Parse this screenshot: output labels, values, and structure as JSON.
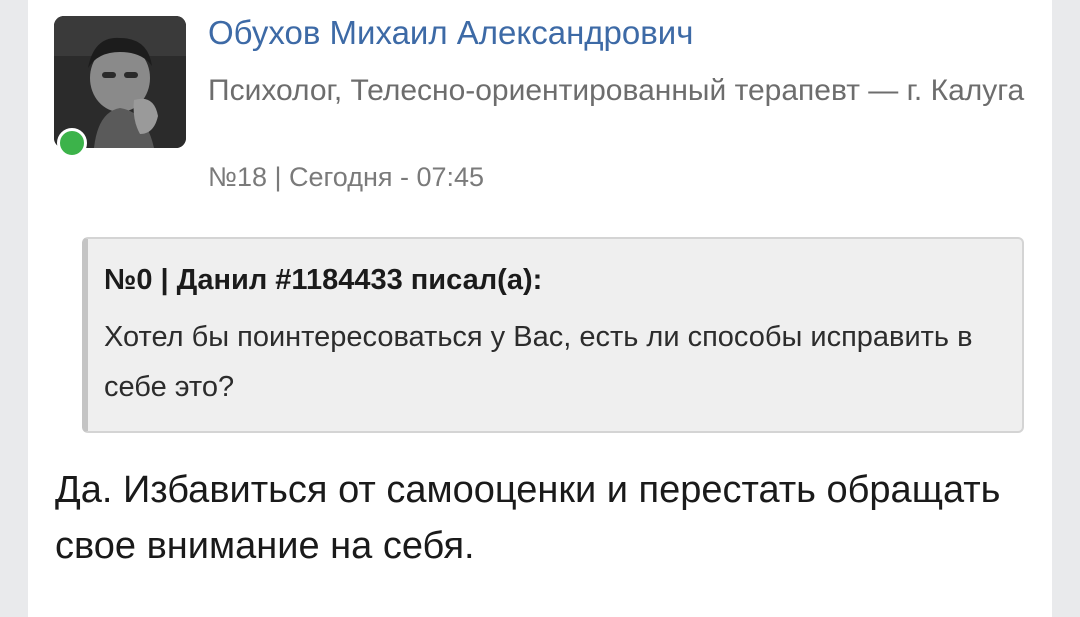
{
  "post": {
    "author_name": "Обухов Михаил Александрович",
    "author_title": "Психолог, Телесно-ориентированный терапевт — г. Калуга",
    "meta": "№18 | Сегодня - 07:45",
    "quote": {
      "header": "№0 | Данил #1184433 писал(а):",
      "text": "Хотел бы поинтересоваться у Вас, есть ли способы исправить в себе это?"
    },
    "reply_text": "Да. Избавиться от самооценки и перестать обращать свое внимание на себя."
  },
  "colors": {
    "name_link": "#3d6aa6",
    "online_status": "#3cb34a",
    "quote_bg": "#efefef"
  },
  "icons": {
    "online": "online-status-dot"
  }
}
